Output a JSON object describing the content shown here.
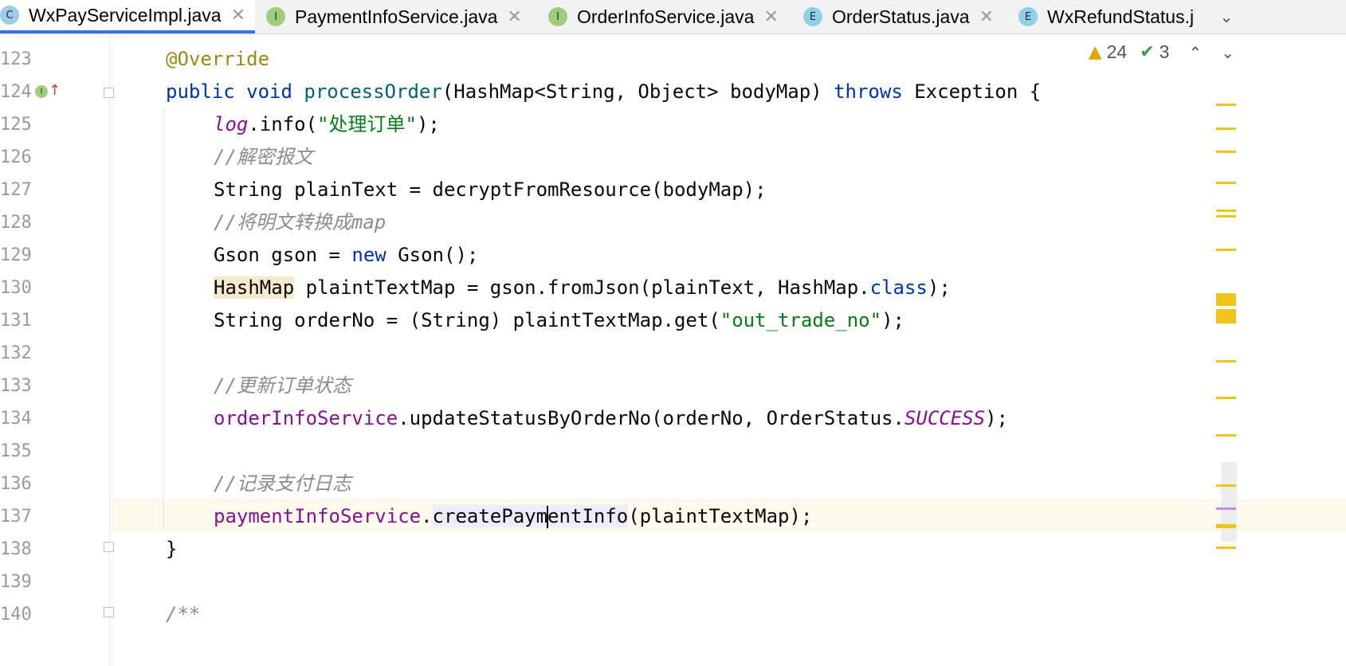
{
  "tabs": [
    {
      "icon": "C",
      "label": "WxPayServiceImpl.java",
      "active": true
    },
    {
      "icon": "I",
      "label": "PaymentInfoService.java",
      "active": false
    },
    {
      "icon": "I",
      "label": "OrderInfoService.java",
      "active": false
    },
    {
      "icon": "E",
      "label": "OrderStatus.java",
      "active": false
    },
    {
      "icon": "E",
      "label": "WxRefundStatus.j",
      "active": false
    }
  ],
  "inspection": {
    "warnings": "24",
    "weak_warnings": "3"
  },
  "line_numbers": [
    "123",
    "124",
    "125",
    "126",
    "127",
    "128",
    "129",
    "130",
    "131",
    "132",
    "133",
    "134",
    "135",
    "136",
    "137",
    "138",
    "139",
    "140"
  ],
  "code": {
    "l123": {
      "annotation": "@Override"
    },
    "l124": {
      "kw1": "public",
      "kw2": "void",
      "method": "processOrder",
      "params": "(HashMap<String, Object> bodyMap) ",
      "throws": "throws",
      "rest": " Exception {"
    },
    "l125": {
      "field": "log",
      "call": ".info(",
      "string": "\"处理订单\"",
      "end": ");"
    },
    "l126": {
      "comment": "//解密报文"
    },
    "l127": {
      "text": "String plainText = decryptFromResource(bodyMap);"
    },
    "l128": {
      "comment": "//将明文转换成map"
    },
    "l129": {
      "a": "Gson gson = ",
      "kw": "new",
      "b": " Gson();"
    },
    "l130": {
      "type": "HashMap",
      "a": " plaintTextMap = gson.fromJson(plainText, HashMap.",
      "kw": "class",
      "b": ");"
    },
    "l131": {
      "a": "String orderNo = (String) plaintTextMap.get(",
      "string": "\"out_trade_no\"",
      "b": ");"
    },
    "l133": {
      "comment": "//更新订单状态"
    },
    "l134": {
      "field": "orderInfoService",
      "a": ".updateStatusByOrderNo(orderNo, OrderStatus.",
      "const": "SUCCESS",
      "b": ");"
    },
    "l136": {
      "comment": "//记录支付日志"
    },
    "l137": {
      "field": "paymentInfoService",
      "dot": ".",
      "m1": "createPaym",
      "m2": "entInfo",
      "b": "(plaintTextMap);"
    },
    "l138": {
      "text": "}"
    },
    "l140": {
      "comment": "/**"
    }
  }
}
